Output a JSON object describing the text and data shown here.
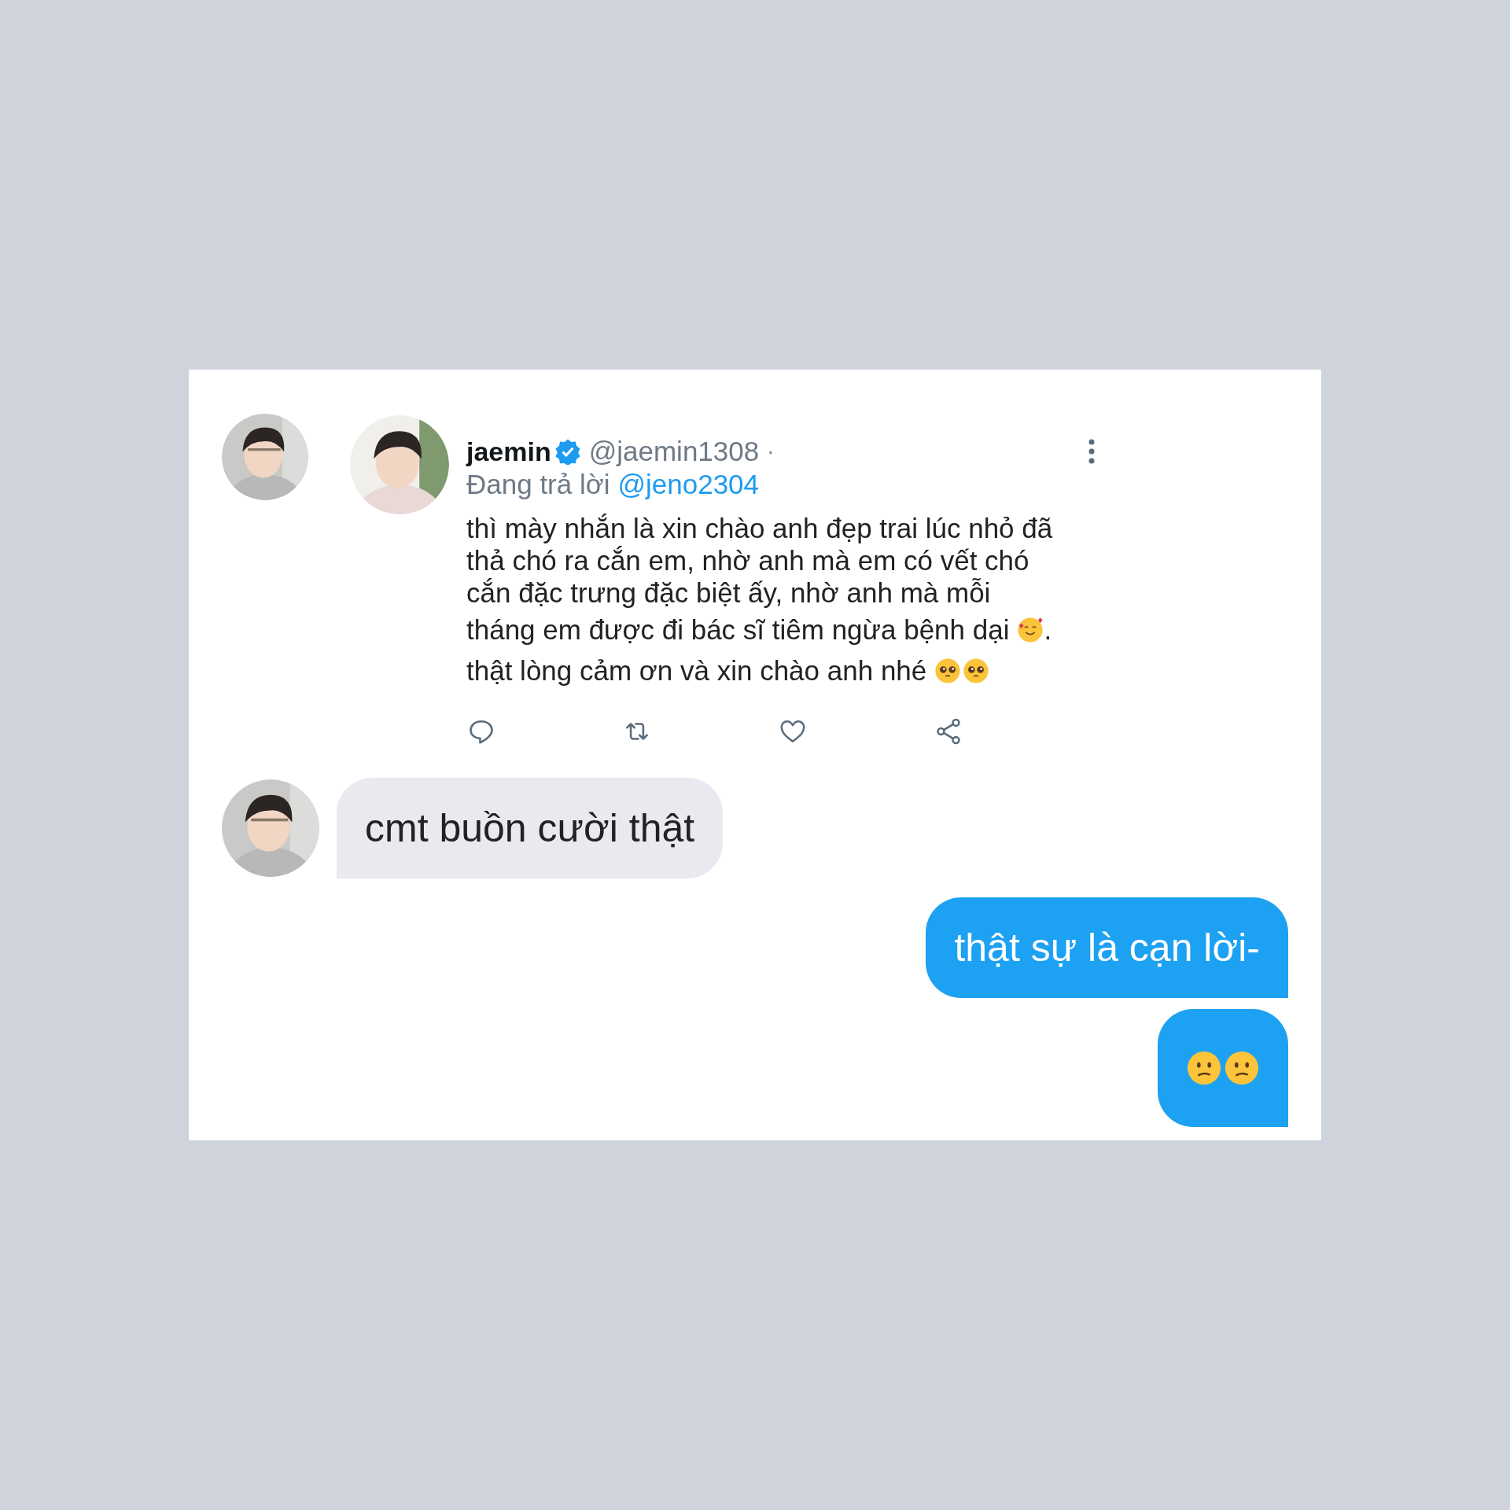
{
  "tweet": {
    "name": "jaemin",
    "verified": true,
    "handle": "@jaemin1308",
    "separator": "·",
    "reply_prefix": "Đang trả lời",
    "reply_to": "@jeno2304",
    "body_lines": [
      {
        "text": "thì mày nhắn là xin chào anh đẹp trai lúc nhỏ đã"
      },
      {
        "text": "thả chó ra cắn em, nhờ anh mà em có vết chó"
      },
      {
        "text": "cắn đặc trưng đặc biệt ấy,  nhờ anh mà mỗi"
      },
      {
        "text": "tháng em được đi bác sĩ tiêm ngừa bệnh dại",
        "emoji_icons": [
          {
            "kind": "hearts"
          }
        ],
        "after": "."
      },
      {
        "text": "thật lòng cảm ơn và xin chào anh nhé",
        "emoji_icons": [
          {
            "kind": "pleading"
          },
          {
            "kind": "pleading"
          }
        ]
      }
    ]
  },
  "messages": [
    {
      "kind": "received",
      "text": "cmt buồn cười thật"
    },
    {
      "kind": "sent",
      "text": "thật sự là cạn lời-"
    },
    {
      "kind": "emoji",
      "emoji_icons": [
        {
          "kind": "confused"
        },
        {
          "kind": "confused"
        }
      ]
    }
  ]
}
